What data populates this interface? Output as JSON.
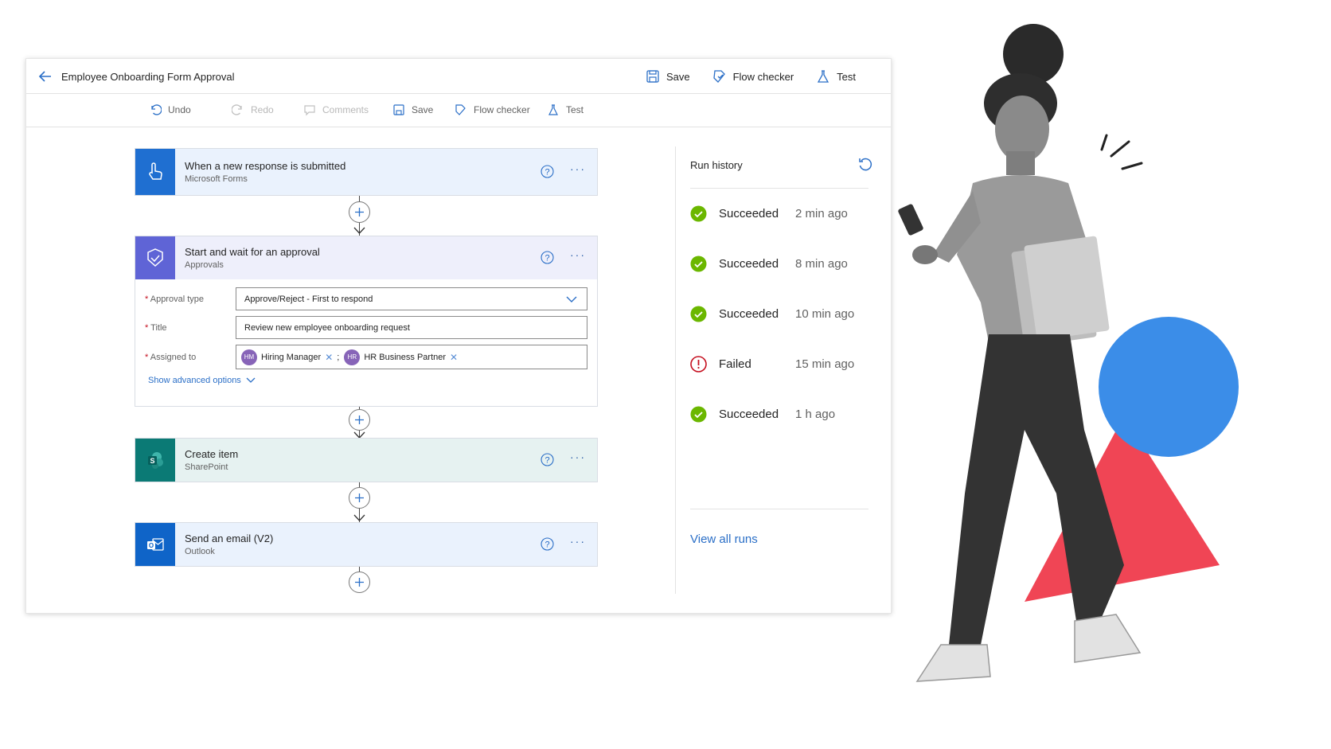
{
  "app": {
    "title": "Employee Onboarding Form Approval",
    "top_actions": {
      "save": "Save",
      "flow_checker": "Flow checker",
      "test": "Test"
    }
  },
  "commands": {
    "undo": "Undo",
    "redo": "Redo",
    "comments": "Comments",
    "save": "Save",
    "flow_checker": "Flow checker",
    "test": "Test"
  },
  "steps": [
    {
      "title": "When a new response is submitted",
      "subtitle": "Microsoft Forms",
      "icon": "touch-icon",
      "color": "#1f6fd1"
    },
    {
      "title": "Start and wait for an approval",
      "subtitle": "Approvals",
      "icon": "approval-icon",
      "color": "#5f64d6"
    },
    {
      "title": "Create item",
      "subtitle": "SharePoint",
      "icon": "sharepoint-icon",
      "color": "#0b7a75"
    },
    {
      "title": "Send an email (V2)",
      "subtitle": "Outlook",
      "icon": "outlook-icon",
      "color": "#0f64c8"
    }
  ],
  "approval": {
    "approval_type_label": "Approval type",
    "approval_type_value": "Approve/Reject - First to respond",
    "title_label": "Title",
    "title_value": "Review new employee onboarding request",
    "assigned_label": "Assigned to",
    "assignees": [
      {
        "initials": "HM",
        "name": "Hiring Manager"
      },
      {
        "initials": "HR",
        "name": "HR Business Partner"
      }
    ],
    "advanced": "Show advanced options",
    "required_mark": "*"
  },
  "run_history": {
    "title": "Run history",
    "runs": [
      {
        "status": "Succeeded",
        "time": "2 min ago",
        "ok": true
      },
      {
        "status": "Succeeded",
        "time": "8 min ago",
        "ok": true
      },
      {
        "status": "Succeeded",
        "time": "10 min ago",
        "ok": true
      },
      {
        "status": "Failed",
        "time": "15 min ago",
        "ok": false
      },
      {
        "status": "Succeeded",
        "time": "1 h ago",
        "ok": true
      }
    ],
    "view_all": "View all runs"
  },
  "colors": {
    "accent": "#2b6fc7",
    "success": "#6bb700",
    "failure": "#c50f1f",
    "circle_blue": "#3b8de8",
    "triangle_red": "#f04555"
  }
}
